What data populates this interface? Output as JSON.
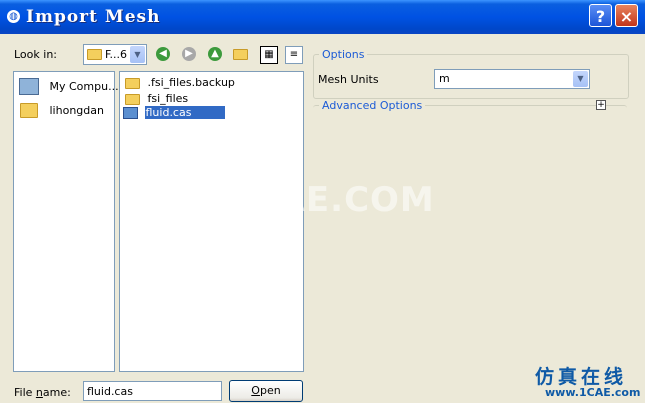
{
  "window": {
    "title": "Import Mesh"
  },
  "titlebar": {
    "help_glyph": "?",
    "close_glyph": "×"
  },
  "look_in": {
    "label": "Look in:",
    "value": "F...6"
  },
  "places": [
    {
      "label": "My Compu..."
    },
    {
      "label": "lihongdan"
    }
  ],
  "files": [
    {
      "name": ".fsi_files.backup",
      "type": "folder"
    },
    {
      "name": "fsi_files",
      "type": "folder"
    },
    {
      "name": "fluid.cas",
      "type": "file",
      "selected": true
    }
  ],
  "file_name": {
    "label_prefix": "File ",
    "label_underlined": "n",
    "label_suffix": "ame:",
    "value": "fluid.cas"
  },
  "open_button": {
    "label_underlined": "O",
    "label_rest": "pen"
  },
  "options": {
    "group_label": "Options",
    "mesh_units_label": "Mesh Units",
    "mesh_units_value": "m",
    "advanced_label": "Advanced Options",
    "advanced_toggle": "+"
  },
  "watermark": {
    "text": "1CAE.COM",
    "cn_text": "仿真在线",
    "url": "www.1CAE.com"
  },
  "colors": {
    "title_bar": "#0052e3",
    "link_label": "#1c5bd6",
    "selection": "#316ac5"
  }
}
